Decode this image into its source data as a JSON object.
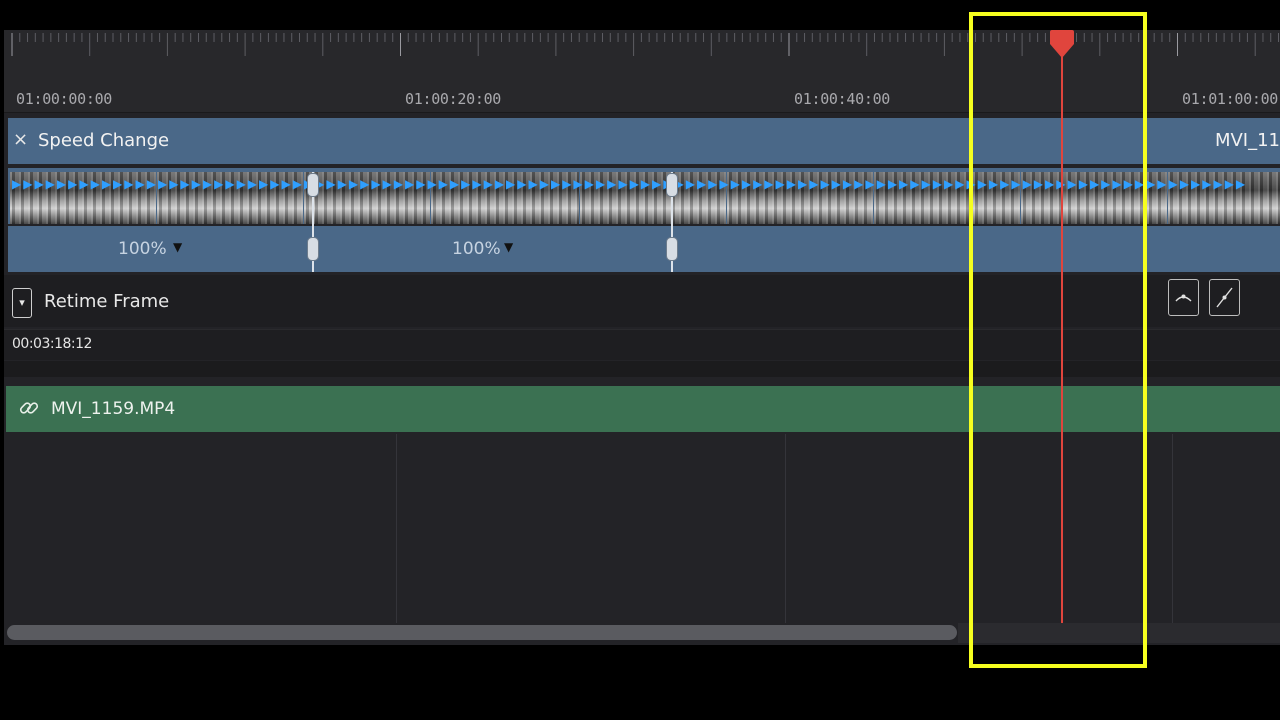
{
  "timeline": {
    "ruler": {
      "timecodes": [
        "01:00:00:00",
        "01:00:20:00",
        "01:00:40:00",
        "01:01:00:00"
      ]
    },
    "speed_change": {
      "title": "Speed Change",
      "close_icon": "×",
      "clip_name_truncated": "MVI_11",
      "segments": [
        {
          "speed": "100%"
        },
        {
          "speed": "100%"
        }
      ]
    },
    "retime": {
      "label": "Retime Frame",
      "toggle_icon": "▾",
      "timecode": "00:03:18:12",
      "curve_buttons": [
        "curve-ease-icon",
        "curve-linear-icon"
      ]
    },
    "audio_clip": {
      "name": "MVI_1159.MP4",
      "icon": "link-icon"
    },
    "colors": {
      "video_clip": "#4a6888",
      "audio_clip": "#3b7152",
      "playhead": "#e0453d",
      "speed_arrows": "#2f9fff",
      "highlight_box": "#f6ff1f"
    }
  }
}
